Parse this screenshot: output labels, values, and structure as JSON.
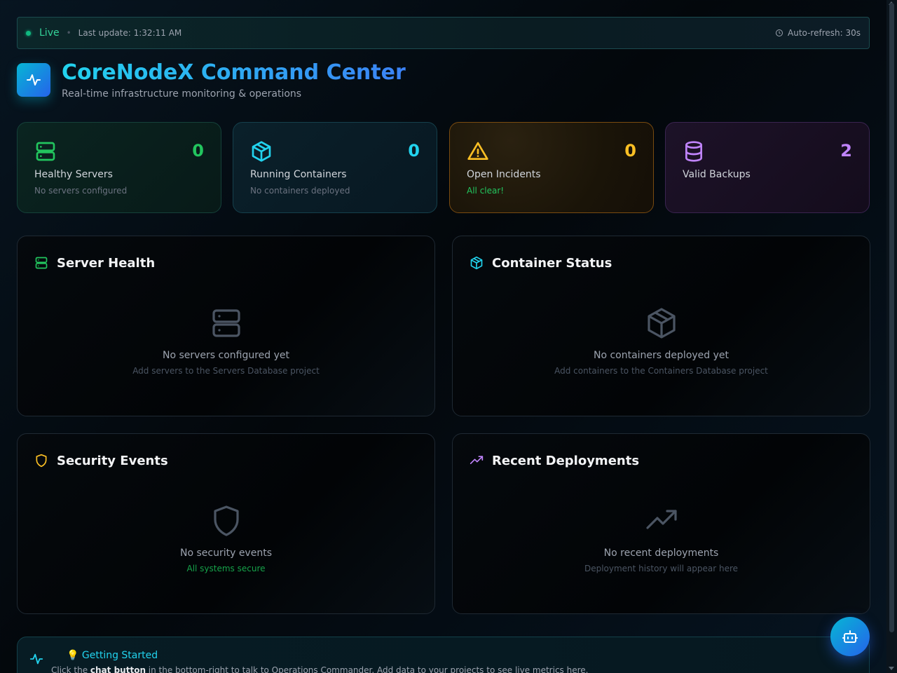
{
  "status_bar": {
    "live_label": "Live",
    "separator": "•",
    "last_update": "Last update: 1:32:11 AM",
    "auto_refresh": "Auto-refresh: 30s"
  },
  "header": {
    "title": "CoreNodeX Command Center",
    "subtitle": "Real-time infrastructure monitoring & operations"
  },
  "stats": [
    {
      "icon": "server-icon",
      "value": "0",
      "label": "Healthy Servers",
      "hint": "No servers configured",
      "color": "#22c55e"
    },
    {
      "icon": "container-icon",
      "value": "0",
      "label": "Running Containers",
      "hint": "No containers deployed",
      "color": "#22d3ee"
    },
    {
      "icon": "warning-icon",
      "value": "0",
      "label": "Open Incidents",
      "hint": "All clear!",
      "color": "#fbbf24",
      "hint_color": "#22c55e"
    },
    {
      "icon": "database-icon",
      "value": "2",
      "label": "Valid Backups",
      "hint": "",
      "color": "#c084fc"
    }
  ],
  "panels": [
    {
      "icon": "server-icon",
      "title": "Server Health",
      "empty_title": "No servers configured yet",
      "empty_sub": "Add servers to the Servers Database project"
    },
    {
      "icon": "container-icon",
      "title": "Container Status",
      "empty_title": "No containers deployed yet",
      "empty_sub": "Add containers to the Containers Database project"
    },
    {
      "icon": "shield-icon",
      "title": "Security Events",
      "empty_title": "No security events",
      "empty_sub": "All systems secure"
    },
    {
      "icon": "trending-up-icon",
      "title": "Recent Deployments",
      "empty_title": "No recent deployments",
      "empty_sub": "Deployment history will appear here"
    }
  ],
  "getting_started": {
    "title": "💡 Getting Started",
    "text_before": "Click the ",
    "text_bold": "chat button",
    "text_after": " in the bottom-right to talk to Operations Commander. Add data to your projects to see live metrics here."
  },
  "fab": {
    "icon": "bot-icon"
  },
  "colors": {
    "accent": "#22d3ee",
    "brand_gradient_start": "#06b6d4",
    "brand_gradient_end": "#2563eb",
    "success": "#22c55e",
    "warning": "#fbbf24",
    "purple": "#c084fc"
  }
}
